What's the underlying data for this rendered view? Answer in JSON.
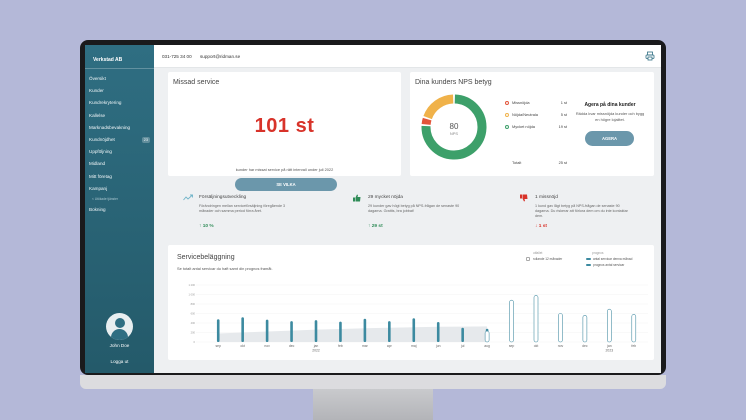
{
  "theme": {
    "accent": "#2f6e82",
    "danger": "#d8332a",
    "success": "#2e8b57",
    "warning": "#f0b24a",
    "promoter": "#3da06a"
  },
  "sidebar": {
    "brand": "Verkstad AB",
    "items": [
      {
        "label": "Översikt"
      },
      {
        "label": "Kunder"
      },
      {
        "label": "Kundrekrytering"
      },
      {
        "label": "Kallelse"
      },
      {
        "label": "Marknadsbevakning"
      },
      {
        "label": "Kundnöjdhet",
        "badge": "23"
      },
      {
        "label": "Uppföljning"
      },
      {
        "label": "Midland"
      },
      {
        "label": "Mitt företag"
      },
      {
        "label": "Kampanj"
      },
      {
        "label": "< Utökade tjänster",
        "sub": true
      },
      {
        "label": "Bokning"
      }
    ],
    "user_name": "John Doe",
    "logout": "Logga ut"
  },
  "topbar": {
    "phone": "031-725 34 00",
    "email": "support@ridman.se",
    "icon": "printer-icon"
  },
  "missed": {
    "title": "Missad service",
    "value": "101 st",
    "subtitle": "kunder har missat service på rätt intervall under juli 2022",
    "button": "SE VILKA"
  },
  "nps": {
    "title": "Dina kunders NPS betyg",
    "score": "80",
    "score_label": "NPS",
    "segments": [
      {
        "name": "Missnöjda",
        "count": "1 st",
        "value": 1,
        "color": "#e2553a"
      },
      {
        "name": "Nöjda/Neutrala",
        "count": "5 st",
        "value": 5,
        "color": "#f0b24a"
      },
      {
        "name": "Mycket nöjda",
        "count": "19 st",
        "value": 19,
        "color": "#3da06a"
      }
    ],
    "total_label": "Totalt",
    "total_value": "25 st",
    "action_title": "Agera på dina kunder",
    "action_text": "Rädda kvar missnöjda kunder och bygg en högre lojalitet.",
    "action_button": "AGERA"
  },
  "stats": [
    {
      "icon": "trend-icon",
      "title": "Försäljningsutveckling",
      "desc": "Förändringen mellan serviceförsäljning föregående 3 månader och samma period förra året.",
      "change": "↑ 10 %",
      "color": "#2e8b57"
    },
    {
      "icon": "thumbs-up-icon",
      "title": "29 mycket nöjda",
      "desc": "29 kunder gav högt betyg på NPS-frågan de senaste 90 dagarna. Grattis, bra jobbat!",
      "change": "↑ 29 st",
      "color": "#2e8b57"
    },
    {
      "icon": "thumbs-down-icon",
      "title": "1 missnöjd",
      "desc": "1 kund gav lågt betyg på NPS-frågan de senaste 90 dagarna. Du riskerar att förlora dem om du inte kontaktar dem.",
      "change": "↓ 1 st",
      "color": "#d8332a"
    }
  ],
  "services": {
    "title": "Servicebeläggning",
    "subtitle": "Se totalt antal servicar du haft samt din prognos framåt.",
    "legend_history_head": "utfallet",
    "legend_history": "rullande 12 månader",
    "legend_forecast_head": "prognos",
    "legend_forecast": [
      "antal servicar denna månad",
      "prognos antal servicar"
    ]
  },
  "chart_data": {
    "type": "bar",
    "categories": [
      "sep",
      "okt",
      "nov",
      "dec",
      "jan",
      "feb",
      "mar",
      "apr",
      "maj",
      "jun",
      "jul",
      "aug",
      "sep",
      "okt",
      "nov",
      "dec",
      "jan",
      "feb"
    ],
    "year_labels": [
      {
        "index": 4,
        "label": "2022"
      },
      {
        "index": 16,
        "label": "2023"
      }
    ],
    "series": [
      {
        "kind": "actual",
        "values": [
          480,
          520,
          470,
          440,
          460,
          430,
          490,
          440,
          500,
          420,
          300,
          280,
          null,
          null,
          null,
          null,
          null,
          null
        ]
      },
      {
        "kind": "forecast",
        "values": [
          null,
          null,
          null,
          null,
          null,
          null,
          null,
          null,
          null,
          null,
          null,
          230,
          880,
          980,
          600,
          560,
          690,
          580
        ]
      }
    ],
    "trend": [
      180,
      200,
      220,
      240,
      260,
      275,
      290,
      300,
      310,
      320,
      325,
      330
    ],
    "yticks": [
      0,
      200,
      400,
      600,
      800,
      1000,
      1200
    ],
    "ylim": [
      0,
      1200
    ]
  }
}
